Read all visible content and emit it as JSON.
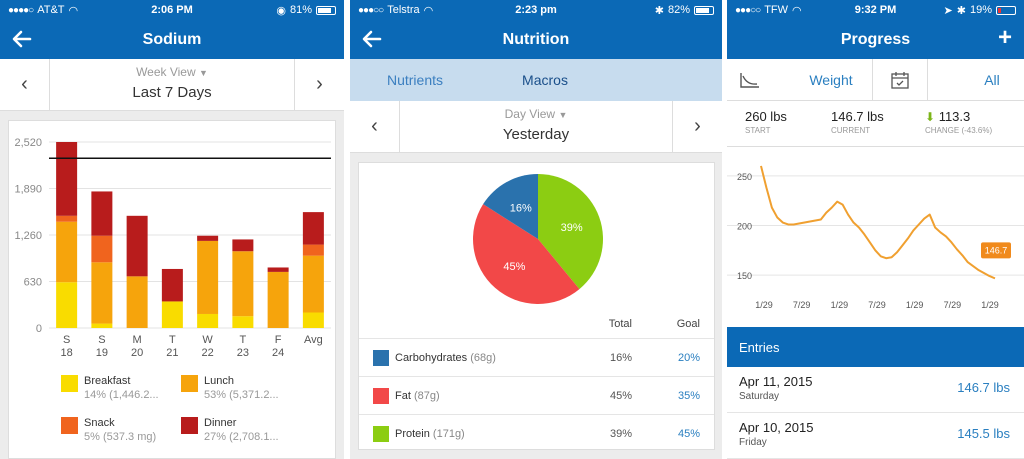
{
  "colors": {
    "brand_blue": "#0b69b6",
    "breakfast": "#f9dc00",
    "lunch": "#f6a40c",
    "snack": "#f0641e",
    "dinner": "#b81c1c",
    "carbs": "#2a72ad",
    "fat": "#f24848",
    "protein": "#8ccd12",
    "weight_line": "#f0a030"
  },
  "phone1": {
    "status": {
      "carrier": "AT&T",
      "time": "2:06 PM",
      "battery": "81%"
    },
    "title": "Sodium",
    "view": "Week View",
    "period": "Last 7 Days",
    "legend": [
      {
        "name": "Breakfast",
        "detail": "14% (1,446.2...",
        "color": "#f9dc00"
      },
      {
        "name": "Lunch",
        "detail": "53% (5,371.2...",
        "color": "#f6a40c"
      },
      {
        "name": "Snack",
        "detail": "5% (537.3 mg)",
        "color": "#f0641e"
      },
      {
        "name": "Dinner",
        "detail": "27% (2,708.1...",
        "color": "#b81c1c"
      }
    ]
  },
  "phone2": {
    "status": {
      "carrier": "Telstra",
      "time": "2:23 pm",
      "battery": "82%"
    },
    "title": "Nutrition",
    "tabs": [
      "Nutrients",
      "Macros"
    ],
    "view": "Day View",
    "period": "Yesterday",
    "table": {
      "col_total": "Total",
      "col_goal": "Goal",
      "rows": [
        {
          "name": "Carbohydrates",
          "grams": "(68g)",
          "total": "16%",
          "goal": "20%",
          "color": "#2a72ad"
        },
        {
          "name": "Fat",
          "grams": "(87g)",
          "total": "45%",
          "goal": "35%",
          "color": "#f24848"
        },
        {
          "name": "Protein",
          "grams": "(171g)",
          "total": "39%",
          "goal": "45%",
          "color": "#8ccd12"
        }
      ]
    }
  },
  "phone3": {
    "status": {
      "carrier": "TFW",
      "time": "9:32 PM",
      "battery": "19%"
    },
    "title": "Progress",
    "tab_weight": "Weight",
    "tab_all": "All",
    "stats": [
      {
        "value": "260 lbs",
        "label": "START"
      },
      {
        "value": "146.7 lbs",
        "label": "CURRENT"
      },
      {
        "value": "113.3",
        "label": "CHANGE (-43.6%)"
      }
    ],
    "entries_title": "Entries",
    "entries": [
      {
        "date": "Apr 11, 2015",
        "weekday": "Saturday",
        "value": "146.7 lbs"
      },
      {
        "date": "Apr 10, 2015",
        "weekday": "Friday",
        "value": "145.5 lbs"
      }
    ]
  },
  "chart_data": [
    {
      "type": "bar",
      "stacked": true,
      "categories": [
        "S 18",
        "S 19",
        "M 20",
        "T 21",
        "W 22",
        "T 23",
        "F 24",
        "Avg"
      ],
      "tick_letters": [
        "S",
        "S",
        "M",
        "T",
        "W",
        "T",
        "F",
        "Avg"
      ],
      "tick_days": [
        "18",
        "19",
        "20",
        "21",
        "22",
        "23",
        "24",
        ""
      ],
      "series": [
        {
          "name": "Breakfast",
          "values": [
            620,
            60,
            0,
            360,
            190,
            160,
            0,
            210
          ]
        },
        {
          "name": "Lunch",
          "values": [
            820,
            830,
            700,
            0,
            990,
            880,
            760,
            770
          ]
        },
        {
          "name": "Snack",
          "values": [
            80,
            360,
            0,
            0,
            0,
            0,
            0,
            150
          ]
        },
        {
          "name": "Dinner",
          "values": [
            1000,
            600,
            820,
            440,
            70,
            160,
            60,
            440
          ]
        }
      ],
      "goal_line": 2300,
      "ylim": [
        0,
        2520
      ],
      "yticks": [
        0,
        630,
        1260,
        1890,
        2520
      ],
      "ytick_labels": [
        "0",
        "630",
        "1,260",
        "1,890",
        "2,520"
      ],
      "grid": true
    },
    {
      "type": "pie",
      "labels": [
        "Carbohydrates",
        "Fat",
        "Protein"
      ],
      "values": [
        16,
        45,
        39
      ],
      "value_labels": [
        "16%",
        "45%",
        "39%"
      ]
    },
    {
      "type": "line",
      "x_tick_labels": [
        "1/29",
        "7/29",
        "1/29",
        "7/29",
        "1/29",
        "7/29",
        "1/29"
      ],
      "yticks": [
        150,
        200,
        250
      ],
      "ylim": [
        135,
        268
      ],
      "grid": true,
      "end_label": "146.7",
      "values": [
        260,
        238,
        218,
        208,
        203,
        201,
        201,
        202,
        203,
        204,
        205,
        206,
        213,
        218,
        224,
        221,
        211,
        203,
        198,
        191,
        183,
        175,
        169,
        167,
        168,
        173,
        180,
        187,
        195,
        201,
        207,
        211,
        198,
        193,
        189,
        183,
        176,
        170,
        163,
        159,
        155,
        152,
        149,
        146.7
      ]
    }
  ]
}
